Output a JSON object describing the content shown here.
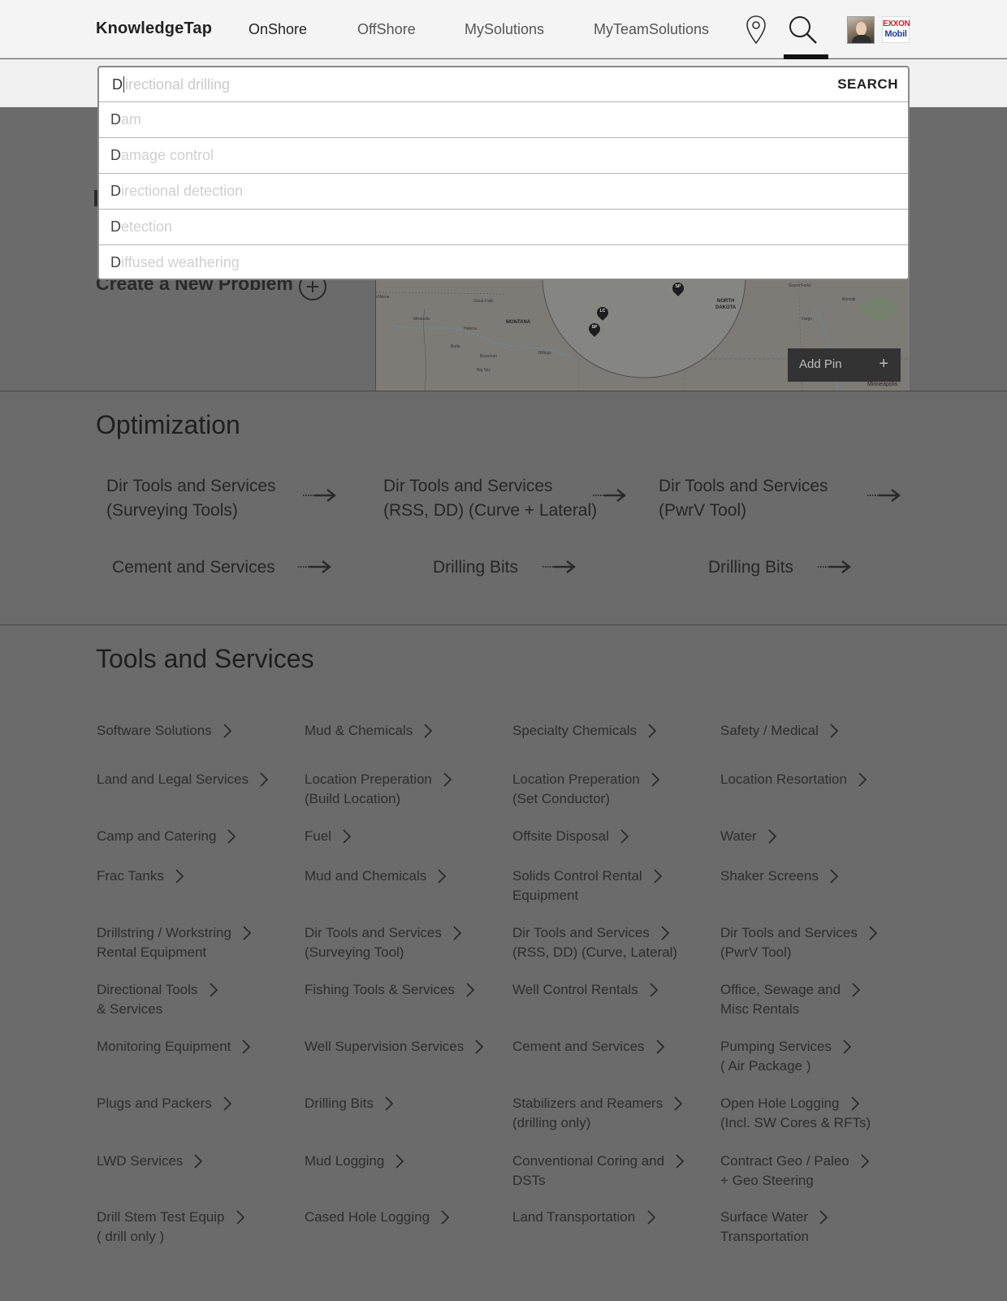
{
  "header": {
    "brand": "KnowledgeTap",
    "nav": [
      "OnShore",
      "OffShore",
      "MySolutions",
      "MyTeamSolutions"
    ],
    "icons": [
      "location-pin-icon",
      "search-icon"
    ],
    "logo": {
      "line1": "EXXON",
      "line2": "Mobil"
    }
  },
  "search": {
    "typed": "D",
    "completion": "irectional drilling",
    "button": "SEARCH",
    "suggestions": [
      {
        "first": "D",
        "rest": "am"
      },
      {
        "first": "D",
        "rest": "amage control"
      },
      {
        "first": "D",
        "rest": "irectional detection"
      },
      {
        "first": "D",
        "rest": "etection"
      },
      {
        "first": "D",
        "rest": "iffused weathering"
      }
    ]
  },
  "problem": {
    "create_label": "Create a New Problem"
  },
  "map": {
    "add_pin": "Add Pin",
    "labels": {
      "montana": "MONTANA",
      "north_dakota_1": "NORTH",
      "north_dakota_2": "DAKOTA",
      "missoula": "Missoula",
      "helena": "Helena",
      "great_falls": "Great Falls",
      "butte": "Butte",
      "bozeman": "Bozeman",
      "billings": "Billings",
      "big_sky": "Big Sky",
      "grand_forks": "Grand Forks",
      "fargo": "Fargo",
      "bemidji": "Bemidji",
      "coeur": "d'Alene",
      "minneapolis": "Minneapolis"
    },
    "pins": [
      "SP",
      "LC",
      "SP"
    ]
  },
  "optimization": {
    "title": "Optimization",
    "items": [
      {
        "line1": "Dir Tools and Services",
        "line2": "(Surveying Tools)"
      },
      {
        "line1": "Dir Tools and Services",
        "line2": "(RSS, DD) (Curve + Lateral)"
      },
      {
        "line1": "Dir Tools and Services",
        "line2": "(PwrV Tool)"
      },
      {
        "line1": "Cement and Services",
        "line2": ""
      },
      {
        "line1": "Drilling Bits",
        "line2": ""
      },
      {
        "line1": "Drilling Bits",
        "line2": ""
      }
    ]
  },
  "tools": {
    "title": "Tools and Services",
    "items": [
      {
        "line1": "Software Solutions",
        "line2": ""
      },
      {
        "line1": "Mud & Chemicals",
        "line2": ""
      },
      {
        "line1": "Specialty Chemicals",
        "line2": ""
      },
      {
        "line1": "Safety / Medical",
        "line2": ""
      },
      {
        "line1": "Land and Legal Services",
        "line2": ""
      },
      {
        "line1": "Location Preperation",
        "line2": "(Build Location)"
      },
      {
        "line1": "Location Preperation",
        "line2": "(Set Conductor)"
      },
      {
        "line1": "Location Resortation",
        "line2": ""
      },
      {
        "line1": "Camp and Catering",
        "line2": ""
      },
      {
        "line1": "Fuel",
        "line2": ""
      },
      {
        "line1": "Offsite Disposal",
        "line2": ""
      },
      {
        "line1": "Water",
        "line2": ""
      },
      {
        "line1": "Frac Tanks",
        "line2": ""
      },
      {
        "line1": "Mud and Chemicals",
        "line2": ""
      },
      {
        "line1": "Solids Control Rental",
        "line2": "Equipment"
      },
      {
        "line1": "Shaker Screens",
        "line2": ""
      },
      {
        "line1": "Drillstring / Workstring",
        "line2": "Rental Equipment"
      },
      {
        "line1": "Dir Tools and Services",
        "line2": "(Surveying Tool)"
      },
      {
        "line1": "Dir Tools and Services",
        "line2": "(RSS, DD) (Curve, Lateral)"
      },
      {
        "line1": "Dir Tools and Services",
        "line2": "(PwrV Tool)"
      },
      {
        "line1": "Directional Tools",
        "line2": "& Services"
      },
      {
        "line1": "Fishing Tools & Services",
        "line2": ""
      },
      {
        "line1": "Well Control Rentals",
        "line2": ""
      },
      {
        "line1": "Office, Sewage and",
        "line2": "Misc Rentals"
      },
      {
        "line1": "Monitoring Equipment",
        "line2": ""
      },
      {
        "line1": "Well Supervision Services",
        "line2": ""
      },
      {
        "line1": "Cement and Services",
        "line2": ""
      },
      {
        "line1": "Pumping Services",
        "line2": "( Air Package )"
      },
      {
        "line1": "Plugs and Packers",
        "line2": ""
      },
      {
        "line1": "Drilling Bits",
        "line2": ""
      },
      {
        "line1": "Stabilizers and Reamers",
        "line2": "(drilling only)"
      },
      {
        "line1": "Open Hole Logging",
        "line2": "(Incl. SW Cores & RFTs)"
      },
      {
        "line1": "LWD Services",
        "line2": ""
      },
      {
        "line1": "Mud Logging",
        "line2": ""
      },
      {
        "line1": "Conventional Coring and",
        "line2": "DSTs"
      },
      {
        "line1": "Contract Geo / Paleo",
        "line2": "+ Geo Steering"
      },
      {
        "line1": "Drill Stem Test Equip",
        "line2": "( drill only )"
      },
      {
        "line1": "Cased Hole Logging",
        "line2": ""
      },
      {
        "line1": "Land Transportation",
        "line2": ""
      },
      {
        "line1": "Surface Water",
        "line2": "Transportation"
      }
    ]
  }
}
